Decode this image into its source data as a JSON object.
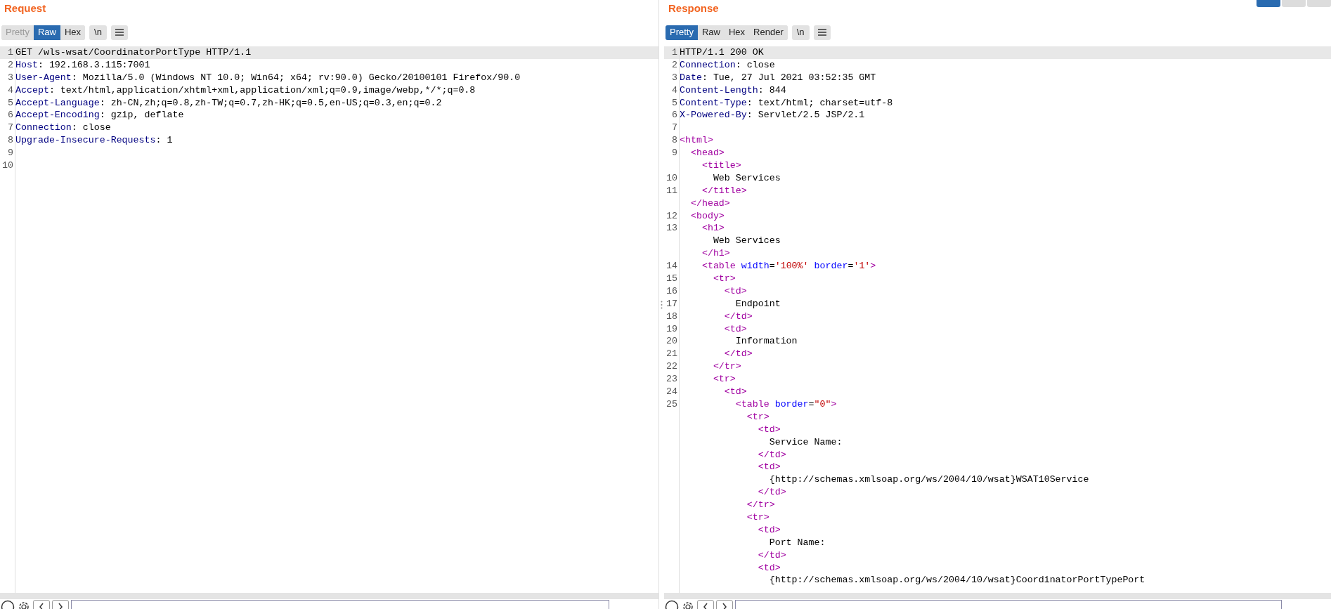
{
  "request": {
    "title": "Request",
    "tabs": [
      {
        "label": "Pretty",
        "selected": false,
        "disabled": true
      },
      {
        "label": "Raw",
        "selected": true,
        "disabled": false
      },
      {
        "label": "Hex",
        "selected": false,
        "disabled": false
      }
    ],
    "newline_button": "\\n",
    "lines": [
      {
        "number": "1",
        "highlighted": true,
        "tokens": [
          {
            "kind": "text",
            "text": "GET /wls-wsat/CoordinatorPortType HTTP/1.1"
          }
        ]
      },
      {
        "number": "2",
        "highlighted": false,
        "tokens": [
          {
            "kind": "name",
            "text": "Host"
          },
          {
            "kind": "text",
            "text": ": 192.168.3.115:7001"
          }
        ]
      },
      {
        "number": "3",
        "highlighted": false,
        "tokens": [
          {
            "kind": "name",
            "text": "User-Agent"
          },
          {
            "kind": "text",
            "text": ": Mozilla/5.0 (Windows NT 10.0; Win64; x64; rv:90.0) Gecko/20100101 Firefox/90.0"
          }
        ]
      },
      {
        "number": "4",
        "highlighted": false,
        "tokens": [
          {
            "kind": "name",
            "text": "Accept"
          },
          {
            "kind": "text",
            "text": ": text/html,application/xhtml+xml,application/xml;q=0.9,image/webp,*/*;q=0.8"
          }
        ]
      },
      {
        "number": "5",
        "highlighted": false,
        "tokens": [
          {
            "kind": "name",
            "text": "Accept-Language"
          },
          {
            "kind": "text",
            "text": ": zh-CN,zh;q=0.8,zh-TW;q=0.7,zh-HK;q=0.5,en-US;q=0.3,en;q=0.2"
          }
        ]
      },
      {
        "number": "6",
        "highlighted": false,
        "tokens": [
          {
            "kind": "name",
            "text": "Accept-Encoding"
          },
          {
            "kind": "text",
            "text": ": gzip, deflate"
          }
        ]
      },
      {
        "number": "7",
        "highlighted": false,
        "tokens": [
          {
            "kind": "name",
            "text": "Connection"
          },
          {
            "kind": "text",
            "text": ": close"
          }
        ]
      },
      {
        "number": "8",
        "highlighted": false,
        "tokens": [
          {
            "kind": "name",
            "text": "Upgrade-Insecure-Requests"
          },
          {
            "kind": "text",
            "text": ": 1"
          }
        ]
      },
      {
        "number": "9",
        "highlighted": false
      },
      {
        "number": "10",
        "highlighted": false
      }
    ]
  },
  "response": {
    "title": "Response",
    "tabs": [
      {
        "label": "Pretty",
        "selected": true,
        "disabled": false
      },
      {
        "label": "Raw",
        "selected": false,
        "disabled": false
      },
      {
        "label": "Hex",
        "selected": false,
        "disabled": false
      },
      {
        "label": "Render",
        "selected": false,
        "disabled": false
      }
    ],
    "newline_button": "\\n",
    "lines": [
      {
        "number": "1",
        "highlighted": true,
        "tokens": [
          {
            "kind": "text",
            "text": "HTTP/1.1 200 OK"
          }
        ]
      },
      {
        "number": "2",
        "highlighted": false,
        "tokens": [
          {
            "kind": "name",
            "text": "Connection"
          },
          {
            "kind": "text",
            "text": ": close"
          }
        ]
      },
      {
        "number": "3",
        "highlighted": false,
        "tokens": [
          {
            "kind": "name",
            "text": "Date"
          },
          {
            "kind": "text",
            "text": ": Tue, 27 Jul 2021 03:52:35 GMT"
          }
        ]
      },
      {
        "number": "4",
        "highlighted": false,
        "tokens": [
          {
            "kind": "name",
            "text": "Content-Length"
          },
          {
            "kind": "text",
            "text": ": 844"
          }
        ]
      },
      {
        "number": "5",
        "highlighted": false,
        "tokens": [
          {
            "kind": "name",
            "text": "Content-Type"
          },
          {
            "kind": "text",
            "text": ": text/html; charset=utf-8"
          }
        ]
      },
      {
        "number": "6",
        "highlighted": false,
        "tokens": [
          {
            "kind": "name",
            "text": "X-Powered-By"
          },
          {
            "kind": "text",
            "text": ": Servlet/2.5 JSP/2.1"
          }
        ]
      },
      {
        "number": "7",
        "highlighted": false
      },
      {
        "number": "8",
        "highlighted": false,
        "tokens": [
          {
            "kind": "tag",
            "text": "<html>"
          }
        ]
      },
      {
        "number": "9",
        "highlighted": false,
        "tokens": [
          {
            "kind": "tag",
            "text": "  <head>"
          }
        ]
      },
      {
        "highlighted": false,
        "tokens": [
          {
            "kind": "tag",
            "text": "    <title>"
          }
        ]
      },
      {
        "number": "10",
        "highlighted": false,
        "tokens": [
          {
            "kind": "text",
            "text": "      Web Services"
          }
        ]
      },
      {
        "number": "11",
        "highlighted": false,
        "tokens": [
          {
            "kind": "tag",
            "text": "    </title>"
          }
        ]
      },
      {
        "highlighted": false,
        "tokens": [
          {
            "kind": "tag",
            "text": "  </head>"
          }
        ]
      },
      {
        "number": "12",
        "highlighted": false,
        "tokens": [
          {
            "kind": "tag",
            "text": "  <body>"
          }
        ]
      },
      {
        "number": "13",
        "highlighted": false,
        "tokens": [
          {
            "kind": "tag",
            "text": "    <h1>"
          }
        ]
      },
      {
        "highlighted": false,
        "tokens": [
          {
            "kind": "text",
            "text": "      Web Services"
          }
        ]
      },
      {
        "highlighted": false,
        "tokens": [
          {
            "kind": "tag",
            "text": "    </h1>"
          }
        ]
      },
      {
        "number": "14",
        "highlighted": false,
        "tokens": [
          {
            "kind": "tag",
            "text": "    <table"
          },
          {
            "kind": "attr",
            "text": " width"
          },
          {
            "kind": "text",
            "text": "="
          },
          {
            "kind": "value",
            "text": "'100%'"
          },
          {
            "kind": "attr",
            "text": " border"
          },
          {
            "kind": "text",
            "text": "="
          },
          {
            "kind": "value",
            "text": "'1'"
          },
          {
            "kind": "tag",
            "text": ">"
          }
        ]
      },
      {
        "number": "15",
        "highlighted": false,
        "tokens": [
          {
            "kind": "tag",
            "text": "      <tr>"
          }
        ]
      },
      {
        "number": "16",
        "highlighted": false,
        "tokens": [
          {
            "kind": "tag",
            "text": "        <td>"
          }
        ]
      },
      {
        "number": "17",
        "highlighted": false,
        "tokens": [
          {
            "kind": "text",
            "text": "          Endpoint"
          }
        ]
      },
      {
        "number": "18",
        "highlighted": false,
        "tokens": [
          {
            "kind": "tag",
            "text": "        </td>"
          }
        ]
      },
      {
        "number": "19",
        "highlighted": false,
        "tokens": [
          {
            "kind": "tag",
            "text": "        <td>"
          }
        ]
      },
      {
        "number": "20",
        "highlighted": false,
        "tokens": [
          {
            "kind": "text",
            "text": "          Information"
          }
        ]
      },
      {
        "number": "21",
        "highlighted": false,
        "tokens": [
          {
            "kind": "tag",
            "text": "        </td>"
          }
        ]
      },
      {
        "number": "22",
        "highlighted": false,
        "tokens": [
          {
            "kind": "tag",
            "text": "      </tr>"
          }
        ]
      },
      {
        "number": "23",
        "highlighted": false,
        "tokens": [
          {
            "kind": "tag",
            "text": "      <tr>"
          }
        ]
      },
      {
        "number": "24",
        "highlighted": false,
        "tokens": [
          {
            "kind": "tag",
            "text": "        <td>"
          }
        ]
      },
      {
        "number": "25",
        "highlighted": false,
        "tokens": [
          {
            "kind": "tag",
            "text": "          <table"
          },
          {
            "kind": "attr",
            "text": " border"
          },
          {
            "kind": "text",
            "text": "="
          },
          {
            "kind": "value",
            "text": "\"0\""
          },
          {
            "kind": "tag",
            "text": ">"
          }
        ]
      },
      {
        "highlighted": false,
        "tokens": [
          {
            "kind": "tag",
            "text": "            <tr>"
          }
        ]
      },
      {
        "highlighted": false,
        "tokens": [
          {
            "kind": "tag",
            "text": "              <td>"
          }
        ]
      },
      {
        "highlighted": false,
        "tokens": [
          {
            "kind": "text",
            "text": "                Service Name:"
          }
        ]
      },
      {
        "highlighted": false,
        "tokens": [
          {
            "kind": "tag",
            "text": "              </td>"
          }
        ]
      },
      {
        "highlighted": false,
        "tokens": [
          {
            "kind": "tag",
            "text": "              <td>"
          }
        ]
      },
      {
        "highlighted": false,
        "tokens": [
          {
            "kind": "text",
            "text": "                {http://schemas.xmlsoap.org/ws/2004/10/wsat}WSAT10Service"
          }
        ]
      },
      {
        "highlighted": false,
        "tokens": [
          {
            "kind": "tag",
            "text": "              </td>"
          }
        ]
      },
      {
        "highlighted": false,
        "tokens": [
          {
            "kind": "tag",
            "text": "            </tr>"
          }
        ]
      },
      {
        "highlighted": false,
        "tokens": [
          {
            "kind": "tag",
            "text": "            <tr>"
          }
        ]
      },
      {
        "highlighted": false,
        "tokens": [
          {
            "kind": "tag",
            "text": "              <td>"
          }
        ]
      },
      {
        "highlighted": false,
        "tokens": [
          {
            "kind": "text",
            "text": "                Port Name:"
          }
        ]
      },
      {
        "highlighted": false,
        "tokens": [
          {
            "kind": "tag",
            "text": "              </td>"
          }
        ]
      },
      {
        "highlighted": false,
        "tokens": [
          {
            "kind": "tag",
            "text": "              <td>"
          }
        ]
      },
      {
        "highlighted": false,
        "tokens": [
          {
            "kind": "text",
            "text": "                {http://schemas.xmlsoap.org/ws/2004/10/wsat}CoordinatorPortTypePort"
          }
        ]
      }
    ]
  },
  "layout_buttons": [
    {
      "selected": true
    },
    {
      "selected": false
    },
    {
      "selected": false
    }
  ]
}
